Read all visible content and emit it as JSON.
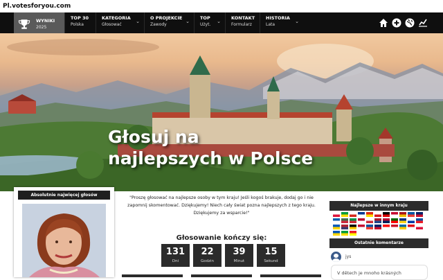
{
  "site": {
    "title": "Pl.votesforyou.com"
  },
  "nav": [
    {
      "label": "WYNIKI",
      "sub": "2025",
      "active": true
    },
    {
      "label": "TOP 30",
      "sub": "Polska"
    },
    {
      "label": "KATEGORIA",
      "sub": "Głosować",
      "dropdown": true
    },
    {
      "label": "O PROJEKCIE",
      "sub": "Zawody",
      "dropdown": true
    },
    {
      "label": "TOP",
      "sub": "Użyt.",
      "dropdown": true
    },
    {
      "label": "KONTAKT",
      "sub": "Formularz"
    },
    {
      "label": "HISTORIA",
      "sub": "Lata",
      "dropdown": true
    }
  ],
  "top_icons": [
    "home-icon",
    "plus-icon",
    "globe-icon",
    "chart-icon"
  ],
  "hero": {
    "line1": "Głosuj na",
    "line2": "najlepszych w Polsce"
  },
  "left_card": {
    "header": "Absolutnie najwięcej głosów"
  },
  "intro": {
    "text": "\"Proszę głosować na najlepsze osoby w tym kraju! Jeśli kogoś brakuje, dodaj go i nie zapomnij skomentować. Dziękujemy! Niech cały świat pozna najlepszych z tego kraju. Dziękujemy za wsparcie!\""
  },
  "countdown": {
    "title": "Głosowanie kończy się:",
    "units": [
      {
        "value": "131",
        "label": "Dni"
      },
      {
        "value": "22",
        "label": "Godzin"
      },
      {
        "value": "39",
        "label": "Minut"
      },
      {
        "value": "15",
        "label": "Sekund"
      }
    ]
  },
  "sidebar": {
    "other_countries_header": "Najlepsze w innym kraju",
    "comments_header": "Ostatnie komentarze",
    "comment_user": "jys",
    "comment_text": "V dětech je mnoho krásných"
  },
  "flag_colors": [
    [
      "#fff",
      "#dc143c"
    ],
    [
      "#009c3b",
      "#ffdf00"
    ],
    [
      "#fff",
      "#d52b1e"
    ],
    [
      "#003893",
      "#fff"
    ],
    [
      "#de2910",
      "#ffde00"
    ],
    [
      "#fff",
      "#d7141a"
    ],
    [
      "#000",
      "#dd0000"
    ],
    [
      "#c60c30",
      "#fff"
    ],
    [
      "#aa151b",
      "#f1bf00"
    ],
    [
      "#0055a4",
      "#ef4135"
    ],
    [
      "#012169",
      "#c8102e"
    ],
    [
      "#0d5eaf",
      "#fff"
    ],
    [
      "#436f4d",
      "#cd2a3e"
    ],
    [
      "#009246",
      "#ce2b37"
    ],
    [
      "#bc002d",
      "#fff"
    ],
    [
      "#fff",
      "#cd2e3a"
    ],
    [
      "#ae1c28",
      "#21468b"
    ],
    [
      "#ba0c2f",
      "#00205b"
    ],
    [
      "#006600",
      "#ff0000"
    ],
    [
      "#002b7f",
      "#fcd116"
    ],
    [
      "#fff",
      "#0039a6"
    ],
    [
      "#0b4ea2",
      "#ee1c25"
    ],
    [
      "#005bbb",
      "#ffd500"
    ],
    [
      "#b22234",
      "#3c3b6e"
    ],
    [
      "#000",
      "#ffce00"
    ],
    [
      "#c60c30",
      "#fff"
    ],
    [
      "#0055a4",
      "#ef4135"
    ],
    [
      "#012169",
      "#c8102e"
    ],
    [
      "#ff0000",
      "#fff"
    ],
    [
      "#ce1126",
      "#fff"
    ],
    [
      "#006aa7",
      "#fecc00"
    ],
    [
      "#e30a17",
      "#fff"
    ],
    [
      "#fff",
      "#dc143c"
    ],
    [
      "#0057b7",
      "#ffd700"
    ],
    [
      "#009c3b",
      "#ffdf00"
    ],
    [
      "#ee1c25",
      "#ffff00"
    ]
  ]
}
